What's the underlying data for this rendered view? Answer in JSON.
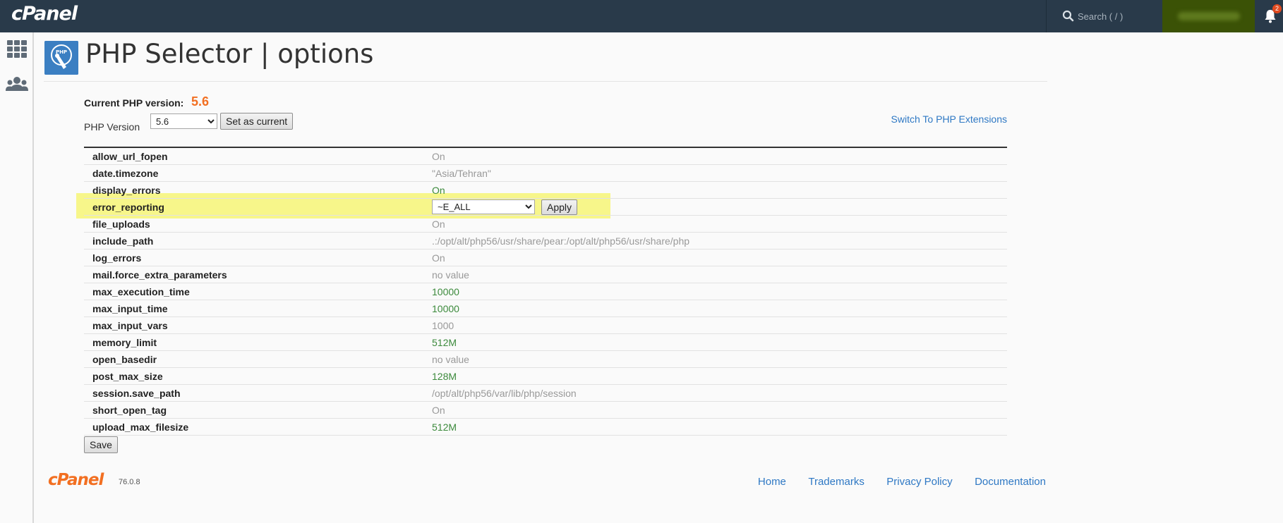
{
  "brand": {
    "logo_text": "cPanel",
    "accent": "#f26f21",
    "topbar_bg": "#293a4a"
  },
  "topbar": {
    "search_placeholder": "Search ( / )",
    "notification_count": "2"
  },
  "page": {
    "title": "PHP Selector | options"
  },
  "version": {
    "current_label": "Current PHP version:",
    "current_value": "5.6",
    "select_label": "PHP Version",
    "selected": "5.6",
    "set_button": "Set as current",
    "switch_link": "Switch To PHP Extensions"
  },
  "options": [
    {
      "name": "allow_url_fopen",
      "value": "On",
      "style": "grey"
    },
    {
      "name": "date.timezone",
      "value": "\"Asia/Tehran\"",
      "style": "grey"
    },
    {
      "name": "display_errors",
      "value": "On",
      "style": "green"
    },
    {
      "name": "error_reporting",
      "value": "~E_ALL",
      "style": "select"
    },
    {
      "name": "file_uploads",
      "value": "On",
      "style": "grey"
    },
    {
      "name": "include_path",
      "value": ".:/opt/alt/php56/usr/share/pear:/opt/alt/php56/usr/share/php",
      "style": "grey"
    },
    {
      "name": "log_errors",
      "value": "On",
      "style": "grey"
    },
    {
      "name": "mail.force_extra_parameters",
      "value": "no value",
      "style": "grey"
    },
    {
      "name": "max_execution_time",
      "value": "10000",
      "style": "green"
    },
    {
      "name": "max_input_time",
      "value": "10000",
      "style": "green"
    },
    {
      "name": "max_input_vars",
      "value": "1000",
      "style": "grey"
    },
    {
      "name": "memory_limit",
      "value": "512M",
      "style": "green"
    },
    {
      "name": "open_basedir",
      "value": "no value",
      "style": "grey"
    },
    {
      "name": "post_max_size",
      "value": "128M",
      "style": "green"
    },
    {
      "name": "session.save_path",
      "value": "/opt/alt/php56/var/lib/php/session",
      "style": "grey"
    },
    {
      "name": "short_open_tag",
      "value": "On",
      "style": "grey"
    },
    {
      "name": "upload_max_filesize",
      "value": "512M",
      "style": "green"
    }
  ],
  "apply_label": "Apply",
  "save_label": "Save",
  "footer": {
    "logo_text": "cPanel",
    "version": "76.0.8",
    "links": [
      "Home",
      "Trademarks",
      "Privacy Policy",
      "Documentation"
    ]
  }
}
